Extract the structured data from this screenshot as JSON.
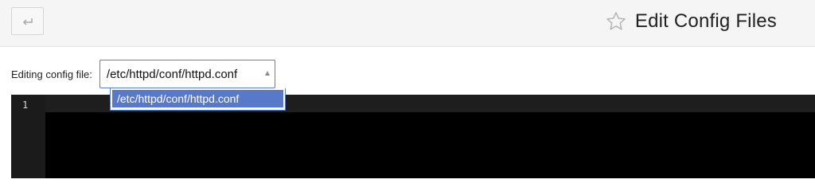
{
  "header": {
    "back_icon": "return-arrow-icon",
    "star_icon": "star-outline-icon",
    "title": "Edit Config Files"
  },
  "config": {
    "label": "Editing config file:",
    "selected": "/etc/httpd/conf/httpd.conf",
    "options": [
      "/etc/httpd/conf/httpd.conf"
    ],
    "dropdown_open": true
  },
  "editor": {
    "line_numbers": [
      "1"
    ],
    "content": "",
    "theme": "dark"
  },
  "colors": {
    "accent": "#5879c9",
    "header_bg": "#f5f5f5",
    "editor_bg": "#000000"
  }
}
